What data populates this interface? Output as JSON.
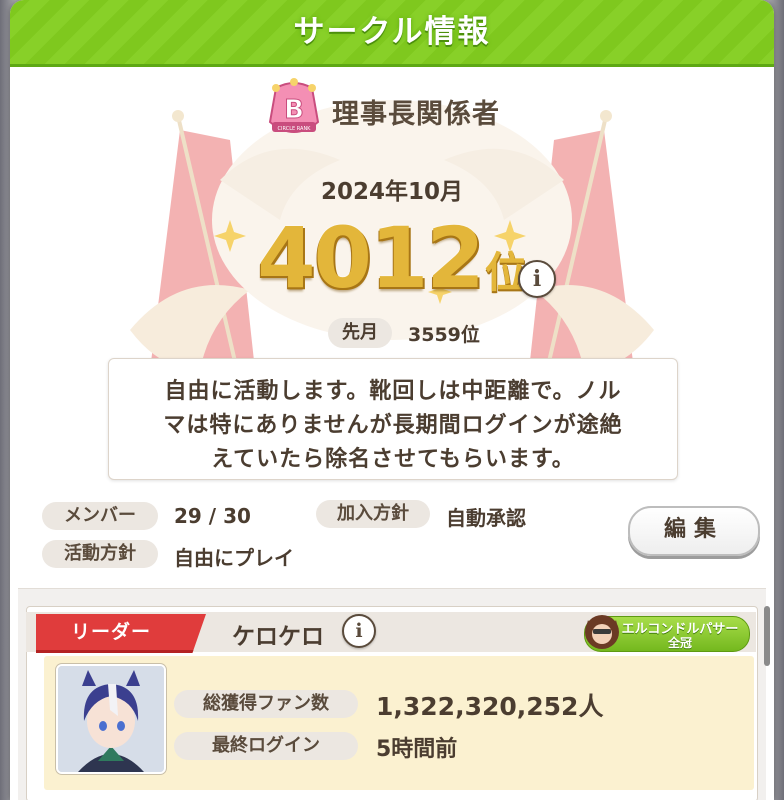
{
  "header": {
    "title": "サークル情報"
  },
  "circle": {
    "rank_letter": "B",
    "rank_caption": "CIRCLE RANK",
    "name": "理事長関係者",
    "month": "2024年10月",
    "rank_number": "4012",
    "rank_suffix": "位",
    "info_symbol": "i",
    "prev_label": "先月",
    "prev_value": "3559位",
    "description": [
      "自由に活動します。靴回しは中距離で。ノル",
      "マは特にありませんが長期間ログインが途絶",
      "えていたら除名させてもらいます。"
    ]
  },
  "stats": {
    "members_label": "メンバー",
    "members_value": "29 / 30",
    "join_label": "加入方針",
    "join_value": "自動承認",
    "activity_label": "活動方針",
    "activity_value": "自由にプレイ"
  },
  "edit_button": "編集",
  "leader": {
    "tag": "リーダー",
    "name": "ケロケロ",
    "info_symbol": "i",
    "title_name": "エルコンドルパサー",
    "title_rank": "全冠",
    "fans_label": "総獲得ファン数",
    "fans_value": "1,322,320,252人",
    "login_label": "最終ログイン",
    "login_value": "5時間前"
  },
  "colors": {
    "header_green": "#7fc81e",
    "rank_gold": "#e3b63a",
    "leader_red": "#e03c3c",
    "card_cream": "#fbf1d0"
  }
}
